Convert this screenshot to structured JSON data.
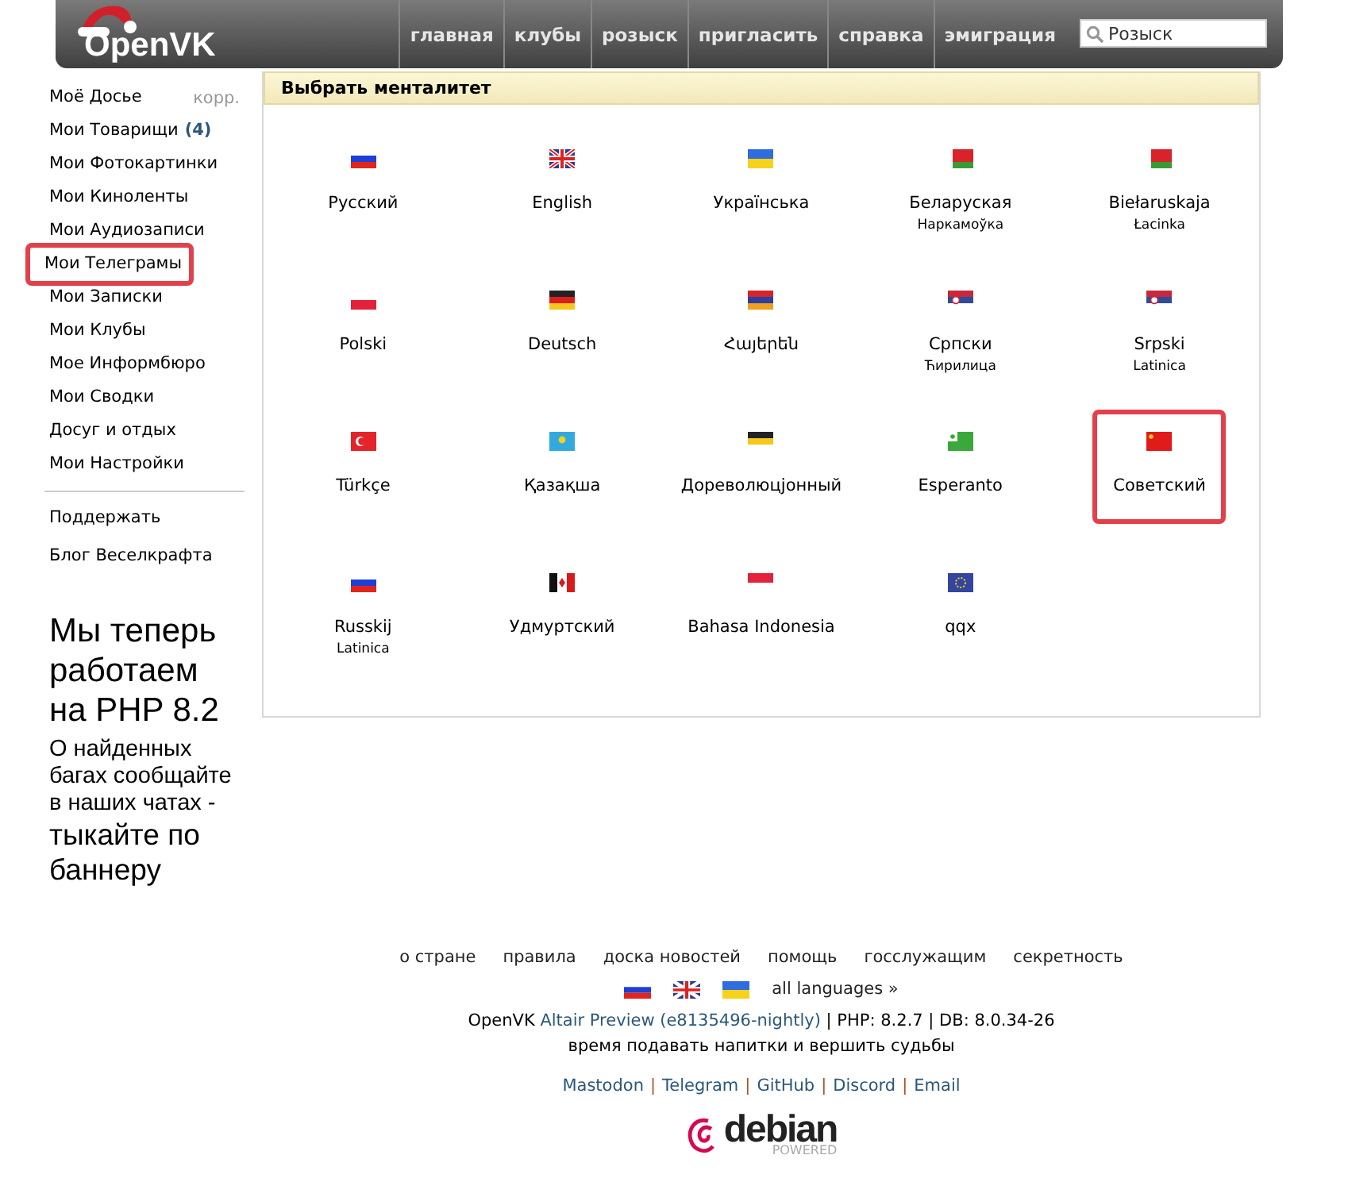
{
  "header": {
    "logo": "OpenVK",
    "nav": [
      "главная",
      "клубы",
      "розыск",
      "пригласить",
      "справка",
      "эмиграция"
    ],
    "search": {
      "placeholder": "Розыск"
    }
  },
  "sidebar": {
    "items": [
      {
        "label": "Моё Досье",
        "extra": "корр.",
        "highlighted": false
      },
      {
        "label": "Мои Товарищи",
        "count": "(4)",
        "highlighted": false
      },
      {
        "label": "Мои Фотокартинки",
        "highlighted": false
      },
      {
        "label": "Мои Киноленты",
        "highlighted": false
      },
      {
        "label": "Мои Аудиозаписи",
        "highlighted": false
      },
      {
        "label": "Мои Телеграмы",
        "highlighted": true
      },
      {
        "label": "Мои Записки",
        "highlighted": false
      },
      {
        "label": "Мои Клубы",
        "highlighted": false
      },
      {
        "label": "Мое Информбюро",
        "highlighted": false
      },
      {
        "label": "Мои Сводки",
        "highlighted": false
      },
      {
        "label": "Досуг и отдых",
        "highlighted": false
      },
      {
        "label": "Мои Настройки",
        "highlighted": false
      }
    ],
    "extra_items": [
      "Поддержать",
      "Блог Веселкрафта"
    ],
    "banner": {
      "headline": "Мы теперь работаем на PHP 8.2",
      "body": "О найденных багах сообщайте в наших чатах -",
      "tail": "тыкайте по баннеру"
    }
  },
  "panel": {
    "title": "Выбрать менталитет",
    "languages": [
      {
        "name": "Русский",
        "highlighted": false
      },
      {
        "name": "English",
        "highlighted": false
      },
      {
        "name": "Українська",
        "highlighted": false
      },
      {
        "name": "Беларуская",
        "sub": "Наркамоўка",
        "highlighted": false
      },
      {
        "name": "Biełaruskaja",
        "sub": "Łacinka",
        "highlighted": false
      },
      {
        "name": "Polski",
        "highlighted": false
      },
      {
        "name": "Deutsch",
        "highlighted": false
      },
      {
        "name": "Հայերեն",
        "highlighted": false
      },
      {
        "name": "Српски",
        "sub": "Ћирилица",
        "highlighted": false
      },
      {
        "name": "Srpski",
        "sub": "Latinica",
        "highlighted": false
      },
      {
        "name": "Türkçe",
        "highlighted": false
      },
      {
        "name": "Қазақша",
        "highlighted": false
      },
      {
        "name": "Дореволюцjонный",
        "highlighted": false
      },
      {
        "name": "Esperanto",
        "highlighted": false
      },
      {
        "name": "Советский",
        "highlighted": true
      },
      {
        "name": "Russkij",
        "sub": "Latinica",
        "highlighted": false
      },
      {
        "name": "Удмуртский",
        "highlighted": false
      },
      {
        "name": "Bahasa Indonesia",
        "highlighted": false
      },
      {
        "name": "qqx",
        "highlighted": false
      }
    ]
  },
  "footer": {
    "links": [
      "о стране",
      "правила",
      "доска новостей",
      "помощь",
      "госслужащим",
      "секретность"
    ],
    "all_languages": "all languages »",
    "version": {
      "prefix": "OpenVK",
      "link": "Altair Preview (e8135496-nightly)",
      "rest": "| PHP: 8.2.7 | DB: 8.0.34-26"
    },
    "motto": "время подавать напитки и вершить судьбы",
    "social": [
      "Mastodon",
      "Telegram",
      "GitHub",
      "Discord",
      "Email"
    ],
    "separator": "|",
    "badge": {
      "name": "debian",
      "sub": "POWERED"
    }
  }
}
